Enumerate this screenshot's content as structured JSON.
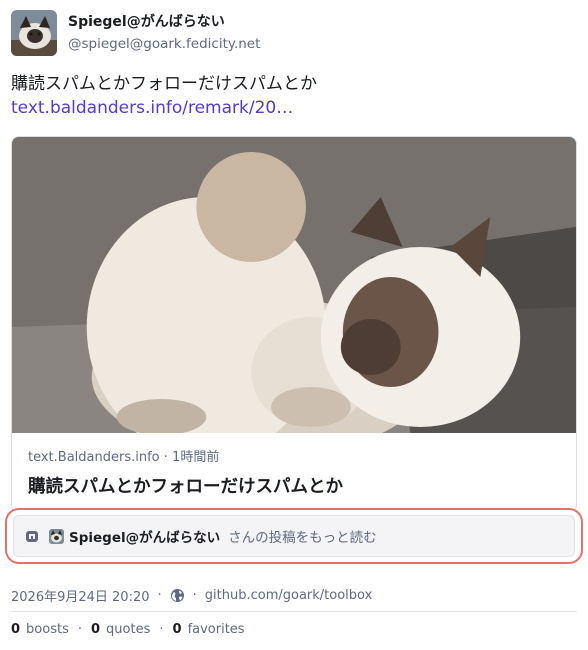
{
  "author": {
    "display_name": "Spiegel@がんばらない",
    "handle": "@spiegel@goark.fedicity.net"
  },
  "post": {
    "text": "購読スパムとかフォローだけスパムとか",
    "link_text": "text.baldanders.info/remark/20…"
  },
  "card": {
    "domain": "text.Baldanders.info",
    "time_ago": "1時間前",
    "meta_separator": "·",
    "title": "購読スパムとかフォローだけスパムとか"
  },
  "read_more": {
    "name": "Spiegel@がんばらない",
    "suffix": "さんの投稿をもっと読む"
  },
  "footer": {
    "timestamp": "2026年9月24日 20:20",
    "separator": "·",
    "source": "github.com/goark/toolbox"
  },
  "stats": {
    "separator": "·",
    "boosts_count": "0",
    "boosts_label": "boosts",
    "quotes_count": "0",
    "quotes_label": "quotes",
    "favorites_count": "0",
    "favorites_label": "favorites"
  },
  "icons": {
    "mastodon": "mastodon-icon",
    "globe": "globe-icon"
  },
  "colors": {
    "link": "#563acc",
    "highlight_border": "#e07468",
    "muted": "#606984"
  }
}
